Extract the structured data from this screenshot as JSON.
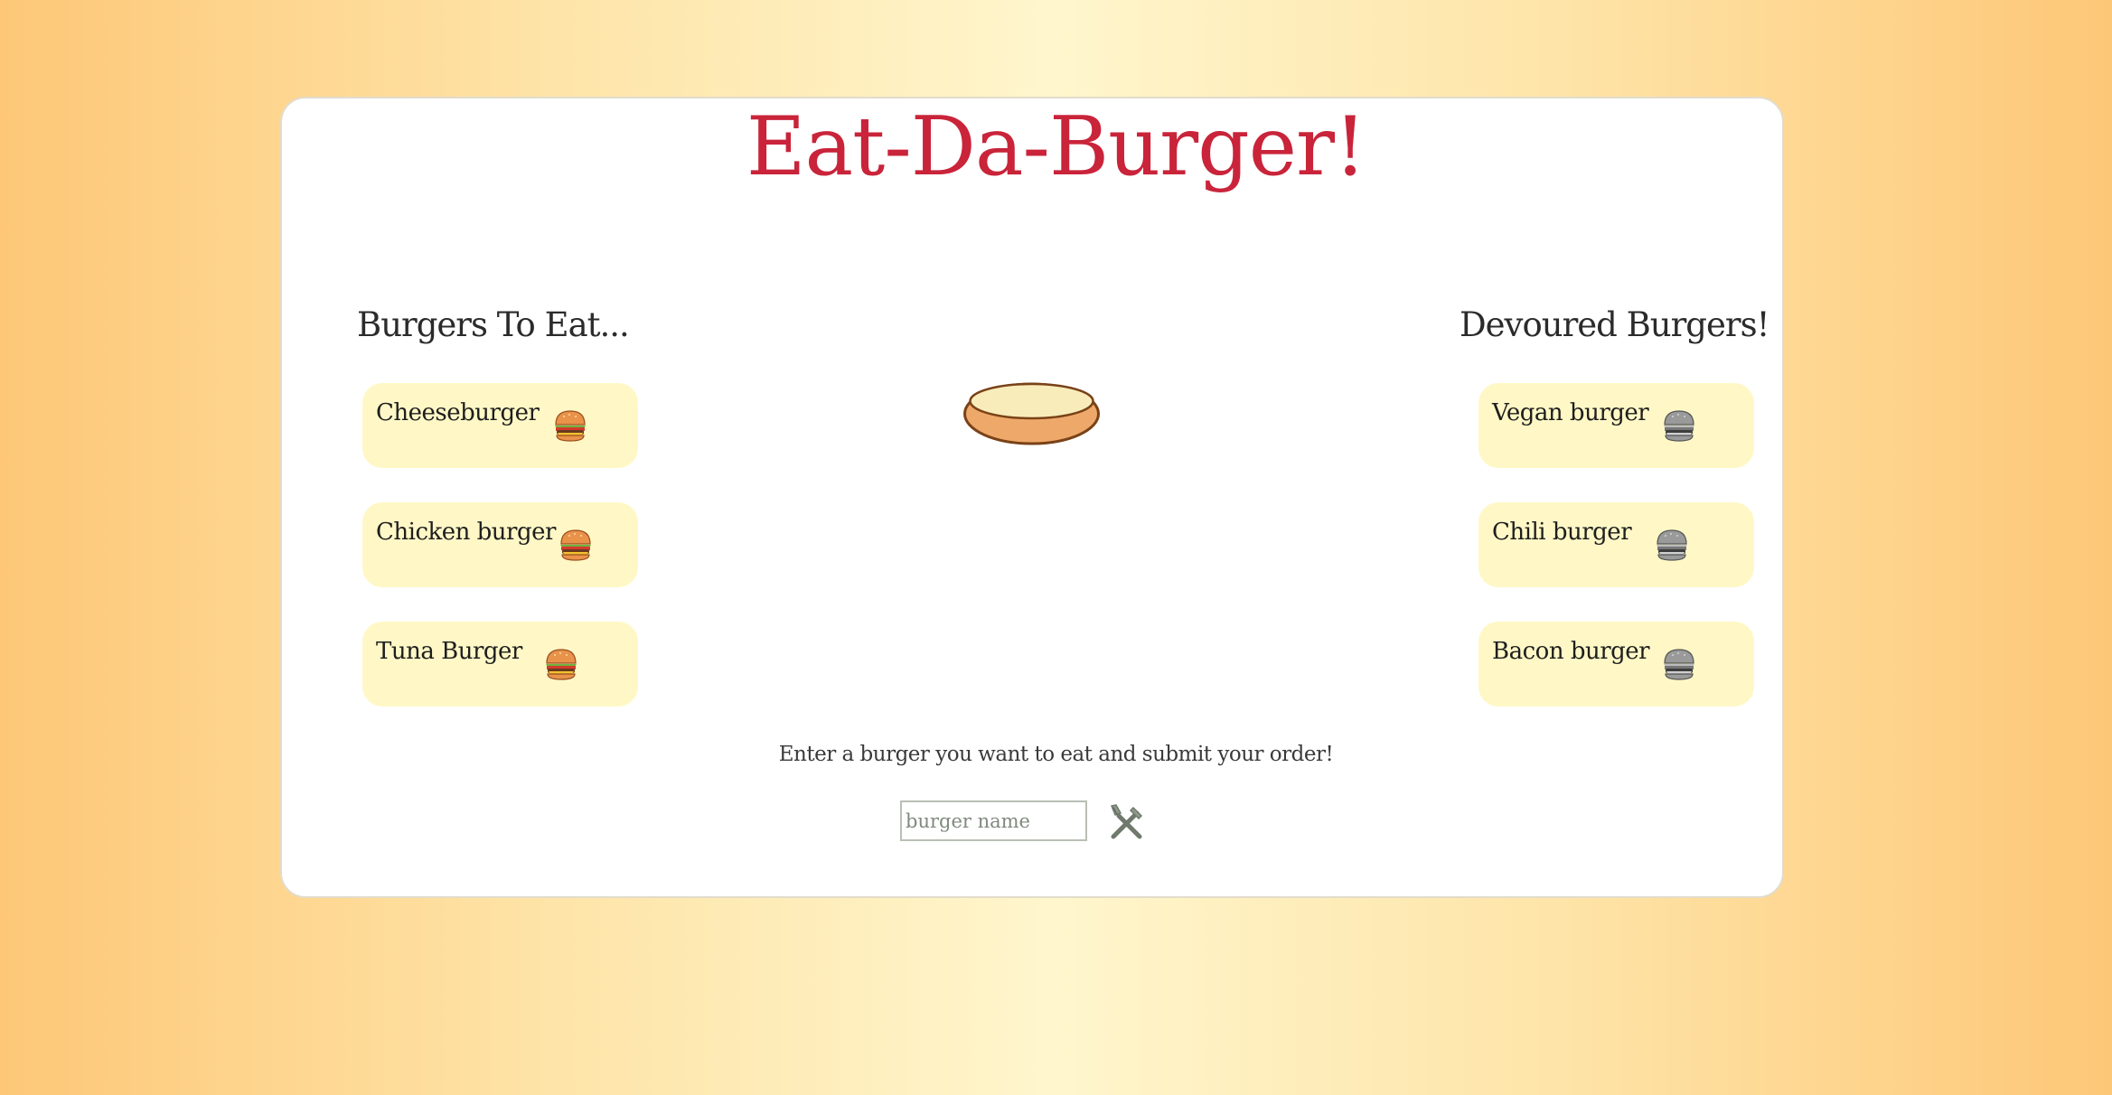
{
  "app": {
    "title": "Eat-Da-Burger!"
  },
  "columns": {
    "to_eat": {
      "heading": "Burgers To Eat...",
      "items": [
        {
          "name": "Cheeseburger",
          "icon": "burger-icon"
        },
        {
          "name": "Chicken burger",
          "icon": "burger-icon"
        },
        {
          "name": "Tuna Burger",
          "icon": "burger-icon"
        }
      ]
    },
    "devoured": {
      "heading": "Devoured Burgers!",
      "items": [
        {
          "name": "Vegan burger",
          "icon": "devoured-burger-icon"
        },
        {
          "name": "Chili burger",
          "icon": "devoured-burger-icon"
        },
        {
          "name": "Bacon burger",
          "icon": "devoured-burger-icon"
        }
      ]
    }
  },
  "order_form": {
    "instructions": "Enter a burger you want to eat and submit your order!",
    "input_placeholder": "burger name",
    "input_value": "",
    "submit_icon": "fork-knife-icon"
  },
  "colors": {
    "title": "#c9243a",
    "item_background": "#fff8c6",
    "background_edge": "#fdc777",
    "background_center": "#fff6cd"
  }
}
